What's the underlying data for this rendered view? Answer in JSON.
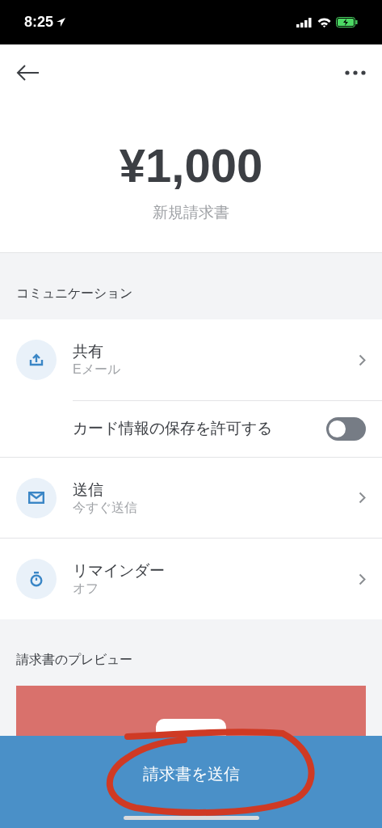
{
  "status_bar": {
    "time": "8:25"
  },
  "amount": "¥1,000",
  "subtitle": "新規請求書",
  "communication": {
    "title": "コミュニケーション",
    "items": [
      {
        "kind": "share",
        "title": "共有",
        "subtitle": "Eメール"
      },
      {
        "kind": "toggle",
        "title": "カード情報の保存を許可する",
        "on": false
      },
      {
        "kind": "send",
        "title": "送信",
        "subtitle": "今すぐ送信"
      },
      {
        "kind": "reminder",
        "title": "リマインダー",
        "subtitle": "オフ"
      }
    ]
  },
  "preview": {
    "title": "請求書のプレビュー",
    "color": "#d9716c"
  },
  "send_button": {
    "label": "請求書を送信"
  }
}
